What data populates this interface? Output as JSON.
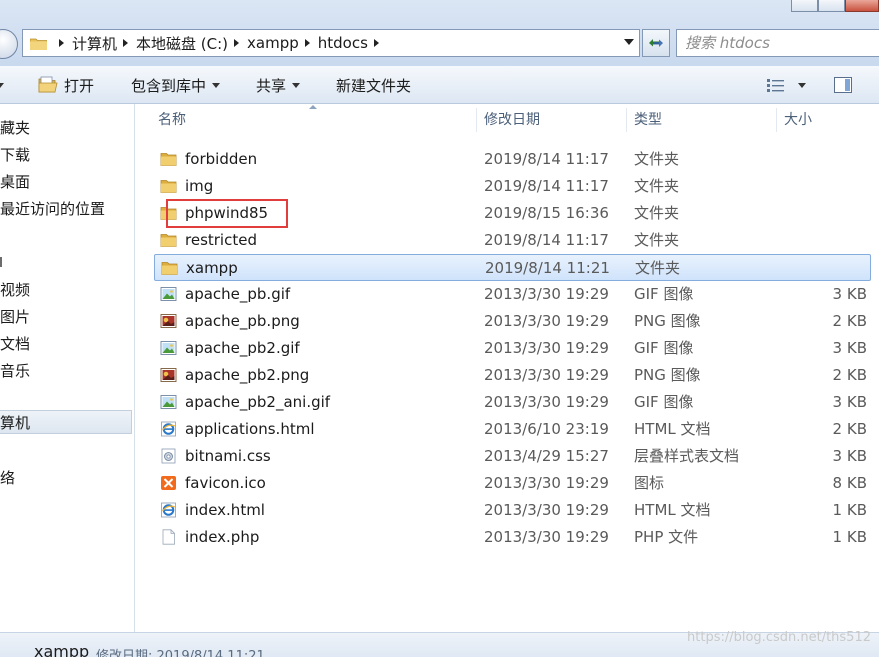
{
  "address": {
    "crumbs": [
      "计算机",
      "本地磁盘 (C:)",
      "xampp",
      "htdocs"
    ]
  },
  "search": {
    "placeholder": "搜索 htdocs"
  },
  "toolbar": {
    "open_label": "打开",
    "include_label": "包含到库中",
    "share_label": "共享",
    "new_folder_label": "新建文件夹"
  },
  "nav": {
    "items": [
      "藏夹",
      "下载",
      "桌面",
      "最近访问的位置",
      "",
      "视频",
      "图片",
      "文档",
      "音乐",
      "算机",
      "络"
    ],
    "selected_label": "算机"
  },
  "columns": {
    "name": "名称",
    "modified": "修改日期",
    "type": "类型",
    "size": "大小"
  },
  "files": [
    {
      "name": "forbidden",
      "date": "2019/8/14 11:17",
      "type": "文件夹",
      "size": "",
      "icon": "folder-icon"
    },
    {
      "name": "img",
      "date": "2019/8/14 11:17",
      "type": "文件夹",
      "size": "",
      "icon": "folder-icon"
    },
    {
      "name": "phpwind85",
      "date": "2019/8/15 16:36",
      "type": "文件夹",
      "size": "",
      "icon": "folder-icon"
    },
    {
      "name": "restricted",
      "date": "2019/8/14 11:17",
      "type": "文件夹",
      "size": "",
      "icon": "folder-icon"
    },
    {
      "name": "xampp",
      "date": "2019/8/14 11:21",
      "type": "文件夹",
      "size": "",
      "icon": "folder-icon"
    },
    {
      "name": "apache_pb.gif",
      "date": "2013/3/30 19:29",
      "type": "GIF 图像",
      "size": "3 KB",
      "icon": "gif-image-icon"
    },
    {
      "name": "apache_pb.png",
      "date": "2013/3/30 19:29",
      "type": "PNG 图像",
      "size": "2 KB",
      "icon": "png-image-icon"
    },
    {
      "name": "apache_pb2.gif",
      "date": "2013/3/30 19:29",
      "type": "GIF 图像",
      "size": "3 KB",
      "icon": "gif-image-icon"
    },
    {
      "name": "apache_pb2.png",
      "date": "2013/3/30 19:29",
      "type": "PNG 图像",
      "size": "2 KB",
      "icon": "png-image-icon"
    },
    {
      "name": "apache_pb2_ani.gif",
      "date": "2013/3/30 19:29",
      "type": "GIF 图像",
      "size": "3 KB",
      "icon": "gif-image-icon"
    },
    {
      "name": "applications.html",
      "date": "2013/6/10 23:19",
      "type": "HTML 文档",
      "size": "2 KB",
      "icon": "ie-html-icon"
    },
    {
      "name": "bitnami.css",
      "date": "2013/4/29 15:27",
      "type": "层叠样式表文档",
      "size": "3 KB",
      "icon": "css-file-icon"
    },
    {
      "name": "favicon.ico",
      "date": "2013/3/30 19:29",
      "type": "图标",
      "size": "8 KB",
      "icon": "xampp-ico-icon"
    },
    {
      "name": "index.html",
      "date": "2013/3/30 19:29",
      "type": "HTML 文档",
      "size": "1 KB",
      "icon": "ie-html-icon"
    },
    {
      "name": "index.php",
      "date": "2013/3/30 19:29",
      "type": "PHP 文件",
      "size": "1 KB",
      "icon": "blank-file-icon"
    }
  ],
  "selected_file_index": 4,
  "details": {
    "name": "xampp",
    "meta": "修改日期: 2019/8/14 11:21"
  },
  "watermark": "https://blog.csdn.net/ths512",
  "colors": {
    "highlight": "#e23d3d",
    "selection_border": "#84acdd",
    "folder": "#e8c15a"
  }
}
